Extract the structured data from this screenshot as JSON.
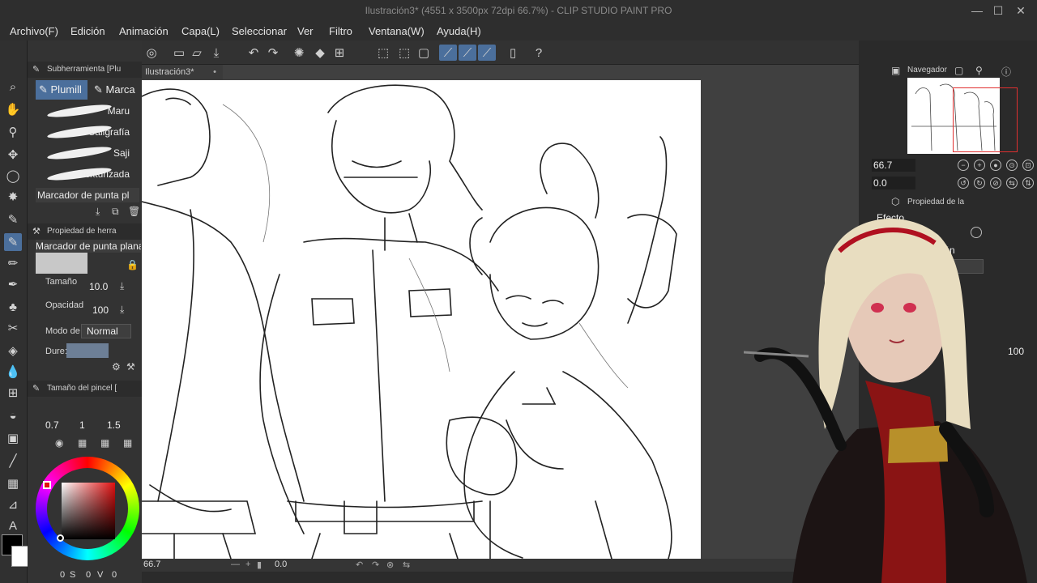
{
  "window": {
    "title": "Ilustración3* (4551 x 3500px 72dpi 66.7%)  - CLIP STUDIO PAINT PRO",
    "minimize": "—",
    "maximize": "☐",
    "close": "✕"
  },
  "menu": [
    "Archivo(F)",
    "Edición",
    "Animación",
    "Capa(L)",
    "Seleccionar",
    "Ver",
    "Filtro",
    "Ventana(W)",
    "Ayuda(H)"
  ],
  "subtool_panel": {
    "header": "Subherramienta [Plu",
    "tabs": [
      "Plumill",
      "Marca"
    ],
    "brushes": [
      "Maru",
      "Caligrafía",
      "Saji",
      "Texturizada"
    ],
    "selected": "Marcador de punta pl"
  },
  "tool_property": {
    "header": "Propiedad de herra",
    "tool_name": "Marcador de punta plana",
    "size_label": "Tamaño",
    "size_value": "10.0",
    "opacity_label": "Opacidad",
    "opacity_value": "100",
    "blend_label": "Modo de c",
    "blend_value": "Normal",
    "hardness_label": "Dure:"
  },
  "brush_size_panel": {
    "header": "Tamaño del pincel [",
    "sizes": [
      "0.7",
      "1",
      "1.5"
    ]
  },
  "document": {
    "tab": "Ilustración3*",
    "zoom": "66.7",
    "angle": "0.0"
  },
  "bottom_bar": {
    "a": "0",
    "b": "S",
    "c": "0",
    "d": "V",
    "e": "0"
  },
  "navigator": {
    "header": "Navegador",
    "zoom": "66.7",
    "angle": "0.0"
  },
  "layer_property": {
    "header": "Propiedad de la",
    "effect_label": "Efecto",
    "expression_label": "resión",
    "color_value": "lor",
    "opacity_value": "100"
  },
  "colors": {
    "accent": "#4b6f9c",
    "main_color": "#000000",
    "sub_color": "#ffffff"
  }
}
